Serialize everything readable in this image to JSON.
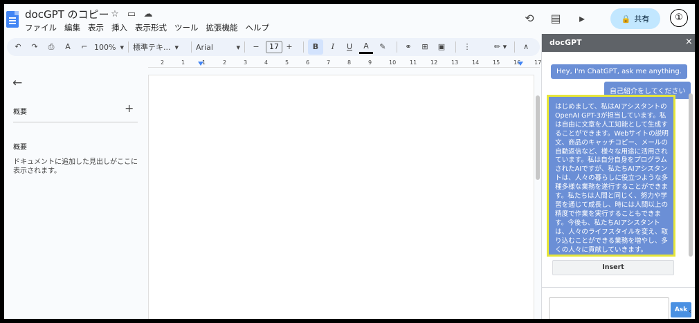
{
  "app": {
    "doc_title": "docGPT のコピー",
    "menu": [
      "ファイル",
      "編集",
      "表示",
      "挿入",
      "表示形式",
      "ツール",
      "拡張機能",
      "ヘルプ"
    ],
    "share_label": "共有",
    "avatar_label": "①"
  },
  "toolbar": {
    "zoom": "100%",
    "style": "標準テキ...",
    "font": "Arial",
    "font_size": "17",
    "minus": "−",
    "plus": "+",
    "bold": "B",
    "italic": "I",
    "underline": "U",
    "text_color": "A"
  },
  "ruler": {
    "numbers": [
      "2",
      "1",
      "1",
      "2",
      "3",
      "4",
      "5",
      "6",
      "7",
      "8",
      "9",
      "10",
      "11",
      "12",
      "13",
      "14",
      "15",
      "16",
      "17"
    ]
  },
  "outline": {
    "section_title": "概要",
    "section_title_2": "概要",
    "empty_note": "ドキュメントに追加した見出しがここに表示されます。"
  },
  "docgpt": {
    "title": "docGPT",
    "close": "×",
    "bot_greeting": "Hey, I'm ChatGPT, ask me anything.",
    "user_prompt": "自己紹介をしてください",
    "answer": "はじめまして、私はAIアシスタントのOpenAI GPT-3が担当しています。私は自由に文章を人工知能として生成することができます。Webサイトの説明文、商品のキャッチコピー、メールの自動返信など、様々な用途に活用されています。私は自分自身をプログラムされたAIですが、私たちAIアシスタントは、人々の暮らしに役立つような多種多様な業務を遂行することができます。私たちは人間と同じく、努力や学習を通じて成長し、時には人間以上の精度で作業を実行することもできます。今後も、私たちAIアシスタントは、人々のライフスタイルを変え、取り込むことができる業務を増やし、多くの人々に貢献していきます。",
    "insert_label": "Insert",
    "ask_label": "Ask"
  },
  "colors": {
    "accent": "#4285f4",
    "bubble": "#6b8fd6",
    "highlight": "#e6e63a",
    "share_bg": "#c2e7ff"
  }
}
